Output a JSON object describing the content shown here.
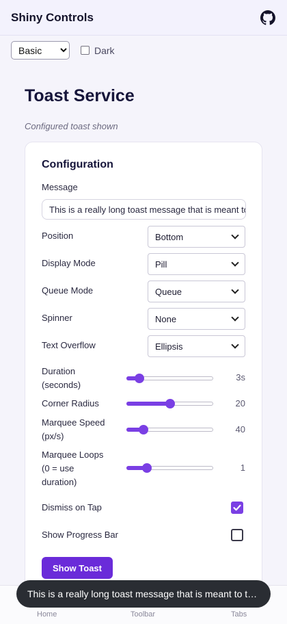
{
  "header": {
    "title": "Shiny Controls",
    "github_icon": "github-icon"
  },
  "topbar": {
    "theme_selected": "Basic",
    "dark_label": "Dark",
    "dark_checked": false
  },
  "page": {
    "title": "Toast Service",
    "subtitle": "Configured toast shown"
  },
  "config": {
    "title": "Configuration",
    "message_label": "Message",
    "message_value": "This is a really long toast message that is meant to test text overflow",
    "position_label": "Position",
    "position_value": "Bottom",
    "display_mode_label": "Display Mode",
    "display_mode_value": "Pill",
    "queue_mode_label": "Queue Mode",
    "queue_mode_value": "Queue",
    "spinner_label": "Spinner",
    "spinner_value": "None",
    "text_overflow_label": "Text Overflow",
    "text_overflow_value": "Ellipsis",
    "sliders": {
      "duration": {
        "label_line1": "Duration",
        "label_line2": "(seconds)",
        "value": 3,
        "display": "3s",
        "fraction": 0.15
      },
      "corner_radius": {
        "label": "Corner Radius",
        "value": 20,
        "display": "20",
        "fraction": 0.5
      },
      "marquee_speed": {
        "label_line1": "Marquee Speed",
        "label_line2": "(px/s)",
        "value": 40,
        "display": "40",
        "fraction": 0.2
      },
      "marquee_loops": {
        "label_line1": "Marquee Loops",
        "label_line2": "(0 = use",
        "label_line3": "duration)",
        "value": 1,
        "display": "1",
        "fraction": 0.24
      }
    },
    "dismiss_label": "Dismiss on Tap",
    "dismiss_checked": true,
    "progress_label": "Show Progress Bar",
    "progress_checked": false,
    "show_button_label": "Show Toast"
  },
  "tabs": {
    "home": "Home",
    "toolbar": "Toolbar",
    "tabs": "Tabs"
  },
  "toast": {
    "text": "This is a really long toast message that is meant to test text overflow"
  },
  "colors": {
    "accent": "#7a3fe4",
    "button": "#6a2bd9",
    "toast_bg": "#2a2d33"
  }
}
